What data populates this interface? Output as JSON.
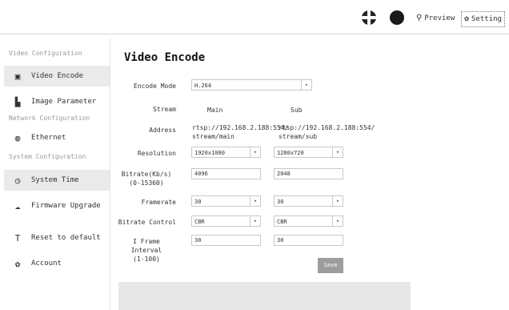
{
  "topbar": {
    "preview_label": "Preview",
    "setting_label": "Setting"
  },
  "sidebar": {
    "section_video": "Video Configuration",
    "item_video_encode": "Video Encode",
    "item_image_parameter": "Image Parameter",
    "section_network": "Network Configuration",
    "item_ethernet": "Ethernet",
    "section_system": "System Configuration",
    "item_system_time": "System Time",
    "item_firmware_upgrade": "Firmware Upgrade",
    "item_reset_default": "Reset to default",
    "item_account": "Account"
  },
  "main": {
    "title": "Video Encode",
    "encode_mode_label": "Encode Mode",
    "encode_mode_value": "H.264",
    "stream_label": "Stream",
    "stream_main": "Main",
    "stream_sub": "Sub",
    "address_label": "Address",
    "address_main": "rtsp://192.168.2.188:554/\nstream/main",
    "address_sub": "rtsp://192.168.2.188:554/\nstream/sub",
    "resolution_label": "Resolution",
    "resolution_main": "1920x1080",
    "resolution_sub": "1280x720",
    "bitrate_label": "Bitrate(Kb/s)\n(0-15360)",
    "bitrate_main": "4096",
    "bitrate_sub": "2048",
    "framerate_label": "Framerate",
    "framerate_main": "30",
    "framerate_sub": "30",
    "bitrate_control_label": "Bitrate Control",
    "bitrate_control_main": "CBR",
    "bitrate_control_sub": "CBR",
    "iframe_label": "I Frame Interval\n(1-100)",
    "iframe_main": "30",
    "iframe_sub": "30",
    "save_label": "Save"
  },
  "icons": {
    "flag": "uk-flag-icon",
    "theme": "circle-icon",
    "preview": "eye-icon",
    "setting": "gear-icon"
  }
}
